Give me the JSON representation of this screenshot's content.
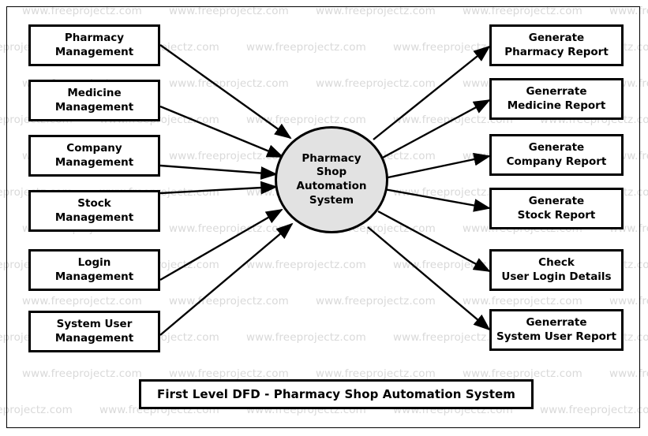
{
  "diagram": {
    "title": "First Level DFD - Pharmacy Shop Automation System",
    "process": {
      "label": "Pharmacy\nShop\nAutomation\nSystem"
    },
    "inputs": [
      {
        "label": "Pharmacy\nManagement"
      },
      {
        "label": "Medicine\nManagement"
      },
      {
        "label": "Company\nManagement"
      },
      {
        "label": "Stock\nManagement"
      },
      {
        "label": "Login\nManagement"
      },
      {
        "label": "System User\nManagement"
      }
    ],
    "outputs": [
      {
        "label": "Generate\nPharmacy Report"
      },
      {
        "label": "Generrate\nMedicine Report"
      },
      {
        "label": "Generate\nCompany Report"
      },
      {
        "label": "Generate\nStock Report"
      },
      {
        "label": "Check\nUser Login Details"
      },
      {
        "label": "Generrate\nSystem User Report"
      }
    ]
  },
  "watermark": {
    "text": "www.freeprojectz.com",
    "color": "#d9d9d9"
  },
  "colors": {
    "process_fill": "#e2e2e2",
    "stroke": "#000000",
    "background": "#ffffff"
  }
}
